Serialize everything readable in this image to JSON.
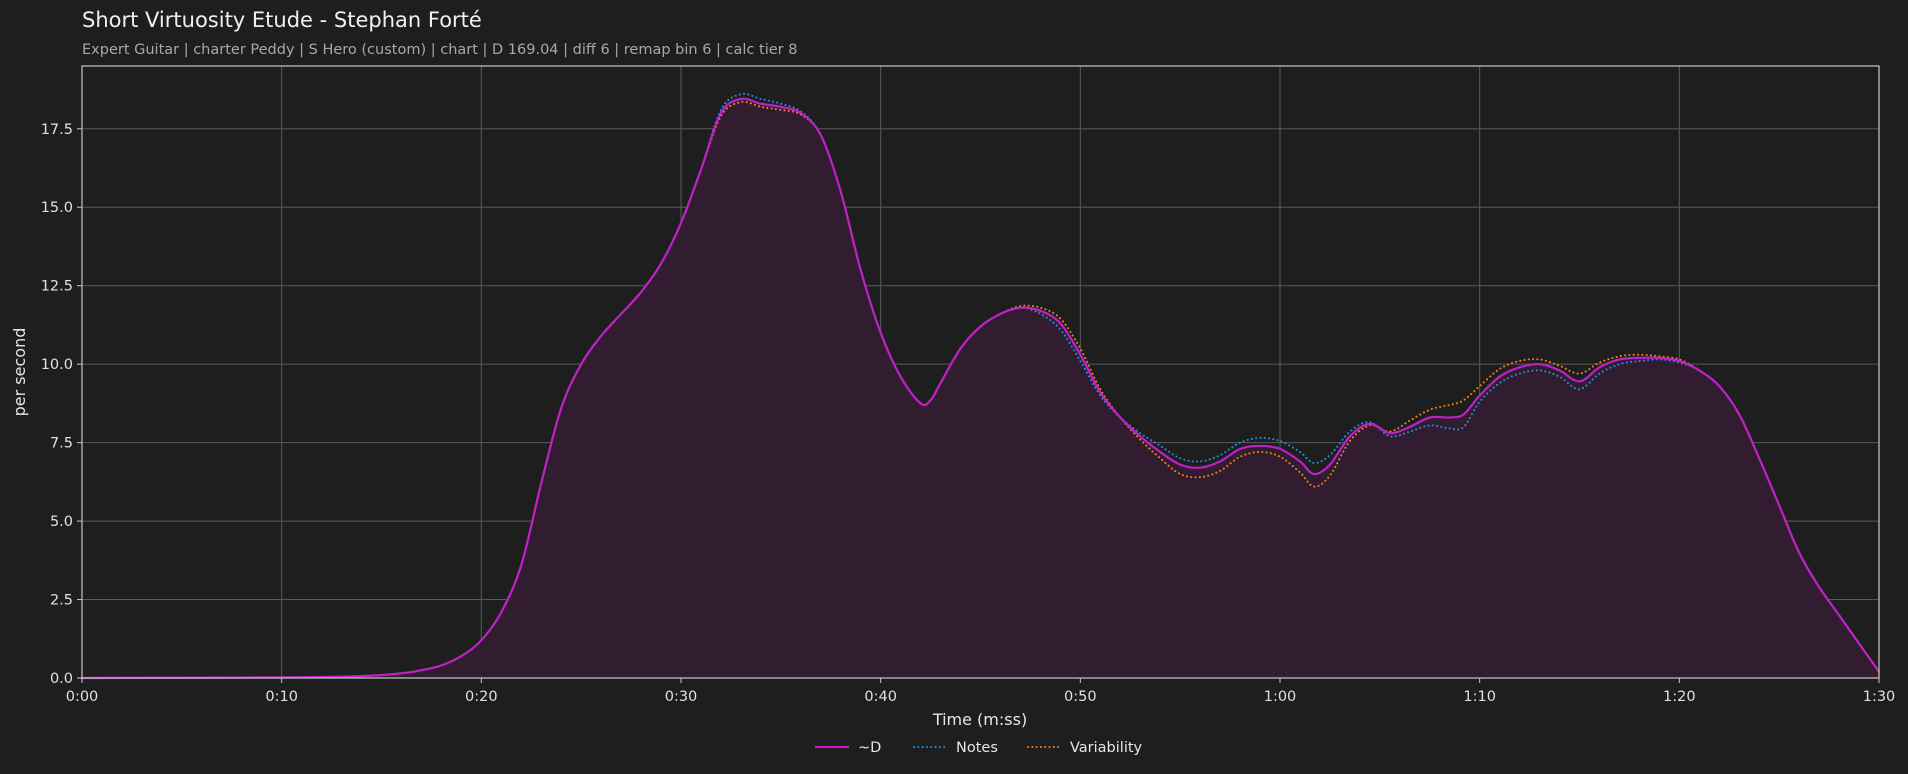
{
  "header": {
    "title": "Short Virtuosity Etude - Stephan Forté",
    "subtitle": "Expert Guitar  |  charter Peddy  |  S Hero (custom)  |  chart  |  D 169.04  |  diff 6  |  remap bin 6  |  calc tier 8"
  },
  "colors": {
    "background": "#1e1e1e",
    "grid": "#5a5a5a",
    "frame": "#c8c8c8",
    "fill": "#311d2f",
    "d": "#c020c8",
    "notes": "#1f8fe0",
    "variability": "#f08020"
  },
  "chart_data": {
    "type": "line",
    "xlabel": "Time (m:ss)",
    "ylabel": "per second",
    "xlim": [
      0,
      90
    ],
    "ylim": [
      0,
      19.5
    ],
    "grid": true,
    "legend_position": "bottom-center",
    "x_ticks": [
      {
        "value": 0,
        "label": "0:00"
      },
      {
        "value": 10,
        "label": "0:10"
      },
      {
        "value": 20,
        "label": "0:20"
      },
      {
        "value": 30,
        "label": "0:30"
      },
      {
        "value": 40,
        "label": "0:40"
      },
      {
        "value": 50,
        "label": "0:50"
      },
      {
        "value": 60,
        "label": "1:00"
      },
      {
        "value": 70,
        "label": "1:10"
      },
      {
        "value": 80,
        "label": "1:20"
      },
      {
        "value": 90,
        "label": "1:30"
      }
    ],
    "y_ticks": [
      {
        "value": 0,
        "label": "0.0"
      },
      {
        "value": 2.5,
        "label": "2.5"
      },
      {
        "value": 5,
        "label": "5.0"
      },
      {
        "value": 7.5,
        "label": "7.5"
      },
      {
        "value": 10,
        "label": "10.0"
      },
      {
        "value": 12.5,
        "label": "12.5"
      },
      {
        "value": 15,
        "label": "15.0"
      },
      {
        "value": 17.5,
        "label": "17.5"
      }
    ],
    "series": [
      {
        "name": "~D",
        "style": "solid",
        "color": "#c020c8",
        "fill": true,
        "points": [
          [
            0,
            0
          ],
          [
            10,
            0.02
          ],
          [
            14,
            0.06
          ],
          [
            16,
            0.15
          ],
          [
            17,
            0.25
          ],
          [
            18,
            0.4
          ],
          [
            19,
            0.7
          ],
          [
            20,
            1.2
          ],
          [
            21,
            2.1
          ],
          [
            22,
            3.6
          ],
          [
            23,
            6.2
          ],
          [
            24,
            8.6
          ],
          [
            25,
            10.0
          ],
          [
            26,
            10.9
          ],
          [
            27,
            11.6
          ],
          [
            28,
            12.3
          ],
          [
            29,
            13.2
          ],
          [
            30,
            14.5
          ],
          [
            31,
            16.2
          ],
          [
            32,
            18.0
          ],
          [
            33,
            18.45
          ],
          [
            34,
            18.3
          ],
          [
            35,
            18.2
          ],
          [
            36,
            18.0
          ],
          [
            37,
            17.3
          ],
          [
            38,
            15.5
          ],
          [
            39,
            13.0
          ],
          [
            40,
            11.0
          ],
          [
            41,
            9.6
          ],
          [
            42,
            8.75
          ],
          [
            42.5,
            8.85
          ],
          [
            43,
            9.4
          ],
          [
            44,
            10.5
          ],
          [
            45,
            11.2
          ],
          [
            46,
            11.6
          ],
          [
            47,
            11.8
          ],
          [
            48,
            11.7
          ],
          [
            49,
            11.3
          ],
          [
            50,
            10.3
          ],
          [
            51,
            9.1
          ],
          [
            52,
            8.3
          ],
          [
            53,
            7.7
          ],
          [
            54,
            7.2
          ],
          [
            55,
            6.8
          ],
          [
            56,
            6.7
          ],
          [
            57,
            6.9
          ],
          [
            58,
            7.3
          ],
          [
            59,
            7.4
          ],
          [
            60,
            7.3
          ],
          [
            61,
            6.9
          ],
          [
            61.7,
            6.5
          ],
          [
            62.5,
            6.8
          ],
          [
            63.5,
            7.7
          ],
          [
            64.5,
            8.1
          ],
          [
            65.5,
            7.8
          ],
          [
            66.5,
            8.0
          ],
          [
            67.5,
            8.3
          ],
          [
            68.5,
            8.3
          ],
          [
            69.2,
            8.4
          ],
          [
            70,
            9.0
          ],
          [
            71,
            9.6
          ],
          [
            72,
            9.9
          ],
          [
            73,
            10.0
          ],
          [
            74,
            9.8
          ],
          [
            75,
            9.45
          ],
          [
            76,
            9.9
          ],
          [
            77,
            10.15
          ],
          [
            78,
            10.2
          ],
          [
            79,
            10.2
          ],
          [
            80,
            10.1
          ],
          [
            81,
            9.8
          ],
          [
            82,
            9.3
          ],
          [
            83,
            8.4
          ],
          [
            84,
            7.0
          ],
          [
            85,
            5.5
          ],
          [
            86,
            4.0
          ],
          [
            87,
            2.9
          ],
          [
            88,
            2.0
          ],
          [
            89,
            1.1
          ],
          [
            90,
            0.2
          ]
        ]
      },
      {
        "name": "Notes",
        "style": "dotted",
        "color": "#1f8fe0",
        "fill": false,
        "points": [
          [
            0,
            0
          ],
          [
            10,
            0.02
          ],
          [
            14,
            0.06
          ],
          [
            16,
            0.15
          ],
          [
            17,
            0.25
          ],
          [
            18,
            0.4
          ],
          [
            19,
            0.7
          ],
          [
            20,
            1.2
          ],
          [
            21,
            2.1
          ],
          [
            22,
            3.6
          ],
          [
            23,
            6.2
          ],
          [
            24,
            8.6
          ],
          [
            25,
            10.0
          ],
          [
            26,
            10.9
          ],
          [
            27,
            11.6
          ],
          [
            28,
            12.3
          ],
          [
            29,
            13.2
          ],
          [
            30,
            14.5
          ],
          [
            31,
            16.2
          ],
          [
            32,
            18.1
          ],
          [
            33,
            18.6
          ],
          [
            34,
            18.45
          ],
          [
            35,
            18.3
          ],
          [
            36,
            18.05
          ],
          [
            37,
            17.3
          ],
          [
            38,
            15.5
          ],
          [
            39,
            13.0
          ],
          [
            40,
            11.0
          ],
          [
            41,
            9.6
          ],
          [
            42,
            8.75
          ],
          [
            42.5,
            8.85
          ],
          [
            43,
            9.4
          ],
          [
            44,
            10.5
          ],
          [
            45,
            11.2
          ],
          [
            46,
            11.6
          ],
          [
            47,
            11.8
          ],
          [
            48,
            11.6
          ],
          [
            49,
            11.1
          ],
          [
            50,
            10.1
          ],
          [
            51,
            9.0
          ],
          [
            52,
            8.3
          ],
          [
            53,
            7.8
          ],
          [
            54,
            7.4
          ],
          [
            55,
            7.0
          ],
          [
            56,
            6.9
          ],
          [
            57,
            7.1
          ],
          [
            58,
            7.5
          ],
          [
            59,
            7.65
          ],
          [
            60,
            7.55
          ],
          [
            61,
            7.2
          ],
          [
            61.7,
            6.85
          ],
          [
            62.5,
            7.1
          ],
          [
            63.5,
            7.85
          ],
          [
            64.5,
            8.15
          ],
          [
            65.5,
            7.7
          ],
          [
            66.5,
            7.85
          ],
          [
            67.5,
            8.05
          ],
          [
            68.5,
            7.95
          ],
          [
            69.2,
            8.0
          ],
          [
            70,
            8.8
          ],
          [
            71,
            9.4
          ],
          [
            72,
            9.7
          ],
          [
            73,
            9.8
          ],
          [
            74,
            9.6
          ],
          [
            75,
            9.2
          ],
          [
            76,
            9.7
          ],
          [
            77,
            10.0
          ],
          [
            78,
            10.1
          ],
          [
            79,
            10.15
          ],
          [
            80,
            10.05
          ],
          [
            81,
            9.8
          ],
          [
            82,
            9.3
          ],
          [
            83,
            8.4
          ],
          [
            84,
            7.0
          ],
          [
            85,
            5.5
          ],
          [
            86,
            4.0
          ],
          [
            87,
            2.9
          ],
          [
            88,
            2.0
          ],
          [
            89,
            1.1
          ],
          [
            90,
            0.2
          ]
        ]
      },
      {
        "name": "Variability",
        "style": "dotted",
        "color": "#f08020",
        "fill": false,
        "points": [
          [
            0,
            0
          ],
          [
            10,
            0.02
          ],
          [
            14,
            0.06
          ],
          [
            16,
            0.15
          ],
          [
            17,
            0.25
          ],
          [
            18,
            0.4
          ],
          [
            19,
            0.7
          ],
          [
            20,
            1.2
          ],
          [
            21,
            2.1
          ],
          [
            22,
            3.6
          ],
          [
            23,
            6.2
          ],
          [
            24,
            8.6
          ],
          [
            25,
            10.0
          ],
          [
            26,
            10.9
          ],
          [
            27,
            11.6
          ],
          [
            28,
            12.3
          ],
          [
            29,
            13.2
          ],
          [
            30,
            14.5
          ],
          [
            31,
            16.2
          ],
          [
            32,
            17.9
          ],
          [
            33,
            18.35
          ],
          [
            34,
            18.2
          ],
          [
            35,
            18.1
          ],
          [
            36,
            17.95
          ],
          [
            37,
            17.3
          ],
          [
            38,
            15.5
          ],
          [
            39,
            13.0
          ],
          [
            40,
            11.0
          ],
          [
            41,
            9.6
          ],
          [
            42,
            8.75
          ],
          [
            42.5,
            8.85
          ],
          [
            43,
            9.4
          ],
          [
            44,
            10.5
          ],
          [
            45,
            11.2
          ],
          [
            46,
            11.6
          ],
          [
            47,
            11.85
          ],
          [
            48,
            11.8
          ],
          [
            49,
            11.45
          ],
          [
            50,
            10.5
          ],
          [
            51,
            9.2
          ],
          [
            52,
            8.3
          ],
          [
            53,
            7.6
          ],
          [
            54,
            7.0
          ],
          [
            55,
            6.5
          ],
          [
            56,
            6.4
          ],
          [
            57,
            6.6
          ],
          [
            58,
            7.05
          ],
          [
            59,
            7.2
          ],
          [
            60,
            7.05
          ],
          [
            61,
            6.55
          ],
          [
            61.7,
            6.1
          ],
          [
            62.5,
            6.45
          ],
          [
            63.5,
            7.55
          ],
          [
            64.5,
            8.05
          ],
          [
            65.5,
            7.85
          ],
          [
            66.5,
            8.2
          ],
          [
            67.5,
            8.55
          ],
          [
            68.5,
            8.7
          ],
          [
            69.2,
            8.85
          ],
          [
            70,
            9.3
          ],
          [
            71,
            9.85
          ],
          [
            72,
            10.1
          ],
          [
            73,
            10.15
          ],
          [
            74,
            9.95
          ],
          [
            75,
            9.7
          ],
          [
            76,
            10.05
          ],
          [
            77,
            10.25
          ],
          [
            78,
            10.3
          ],
          [
            79,
            10.25
          ],
          [
            80,
            10.15
          ],
          [
            81,
            9.8
          ],
          [
            82,
            9.3
          ],
          [
            83,
            8.4
          ],
          [
            84,
            7.0
          ],
          [
            85,
            5.5
          ],
          [
            86,
            4.0
          ],
          [
            87,
            2.9
          ],
          [
            88,
            2.0
          ],
          [
            89,
            1.1
          ],
          [
            90,
            0.2
          ]
        ]
      }
    ]
  }
}
